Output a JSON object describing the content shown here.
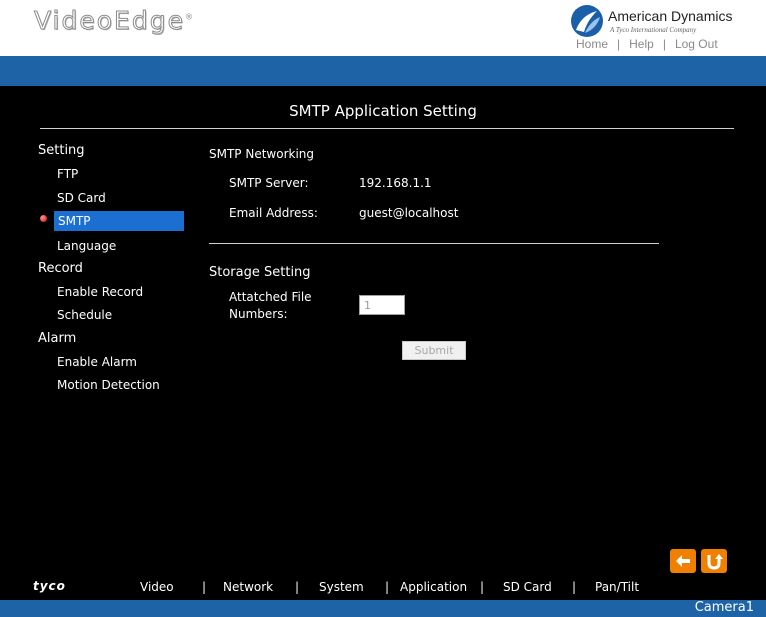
{
  "header": {
    "brand": "VideoEdge",
    "brand_mark": "®",
    "company": "American Dynamics",
    "company_tagline": "A Tyco International Company",
    "links": {
      "home": "Home",
      "help": "Help",
      "logout": "Log Out"
    },
    "link_separator": "|"
  },
  "page": {
    "title": "SMTP Application Setting"
  },
  "sidebar": {
    "sections": [
      {
        "label": "Setting",
        "items": [
          "FTP",
          "SD Card",
          "SMTP",
          "Language"
        ]
      },
      {
        "label": "Record",
        "items": [
          "Enable Record",
          "Schedule"
        ]
      },
      {
        "label": "Alarm",
        "items": [
          "Enable Alarm",
          "Motion Detection"
        ]
      }
    ],
    "active_item": "SMTP"
  },
  "smtp_networking": {
    "heading": "SMTP Networking",
    "server_label": "SMTP Server:",
    "server_value": "192.168.1.1",
    "email_label": "Email Address:",
    "email_value": "guest@localhost"
  },
  "storage_setting": {
    "heading": "Storage Setting",
    "attached_label_line1": "Attatched File",
    "attached_label_line2": "Numbers:",
    "attached_value": "1"
  },
  "submit_label": "Submit",
  "icons": {
    "back": "arrow-left-icon",
    "refresh": "u-turn-icon"
  },
  "footer": {
    "logo": "tyco",
    "nav": [
      "Video",
      "Network",
      "System",
      "Application",
      "SD Card",
      "Pan/Tilt"
    ],
    "separator": "|",
    "camera": "Camera1"
  },
  "colors": {
    "accent_blue": "#1e63a6",
    "active_item": "#1a6fd0",
    "button_orange": "#f08000",
    "background": "#000000"
  }
}
